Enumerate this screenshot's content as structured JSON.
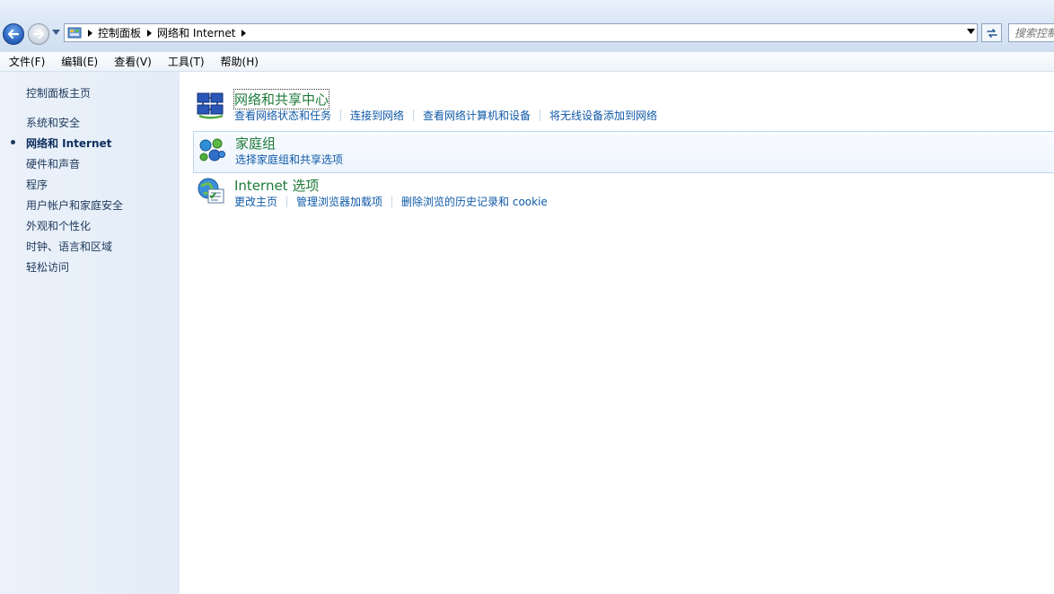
{
  "address_bar": {
    "crumbs": [
      "控制面板",
      "网络和 Internet"
    ],
    "search_placeholder": "搜索控制面板"
  },
  "menu": {
    "items": [
      "文件(F)",
      "编辑(E)",
      "查看(V)",
      "工具(T)",
      "帮助(H)"
    ]
  },
  "sidebar": {
    "home": "控制面板主页",
    "items": [
      {
        "label": "系统和安全"
      },
      {
        "label": "网络和 Internet",
        "active": true
      },
      {
        "label": "硬件和声音"
      },
      {
        "label": "程序"
      },
      {
        "label": "用户帐户和家庭安全"
      },
      {
        "label": "外观和个性化"
      },
      {
        "label": "时钟、语言和区域"
      },
      {
        "label": "轻松访问"
      }
    ]
  },
  "categories": [
    {
      "title": "网络和共享中心",
      "icon": "network-sharing-center-icon",
      "links": [
        "查看网络状态和任务",
        "连接到网络",
        "查看网络计算机和设备",
        "将无线设备添加到网络"
      ]
    },
    {
      "title": "家庭组",
      "icon": "homegroup-icon",
      "links": [
        "选择家庭组和共享选项"
      ]
    },
    {
      "title": "Internet 选项",
      "icon": "internet-options-icon",
      "links": [
        "更改主页",
        "管理浏览器加载项",
        "删除浏览的历史记录和 cookie"
      ]
    }
  ],
  "colors": {
    "link": "#0f5aa8",
    "category_title": "#1e7a3a",
    "sidebar_text": "#1e395b"
  }
}
